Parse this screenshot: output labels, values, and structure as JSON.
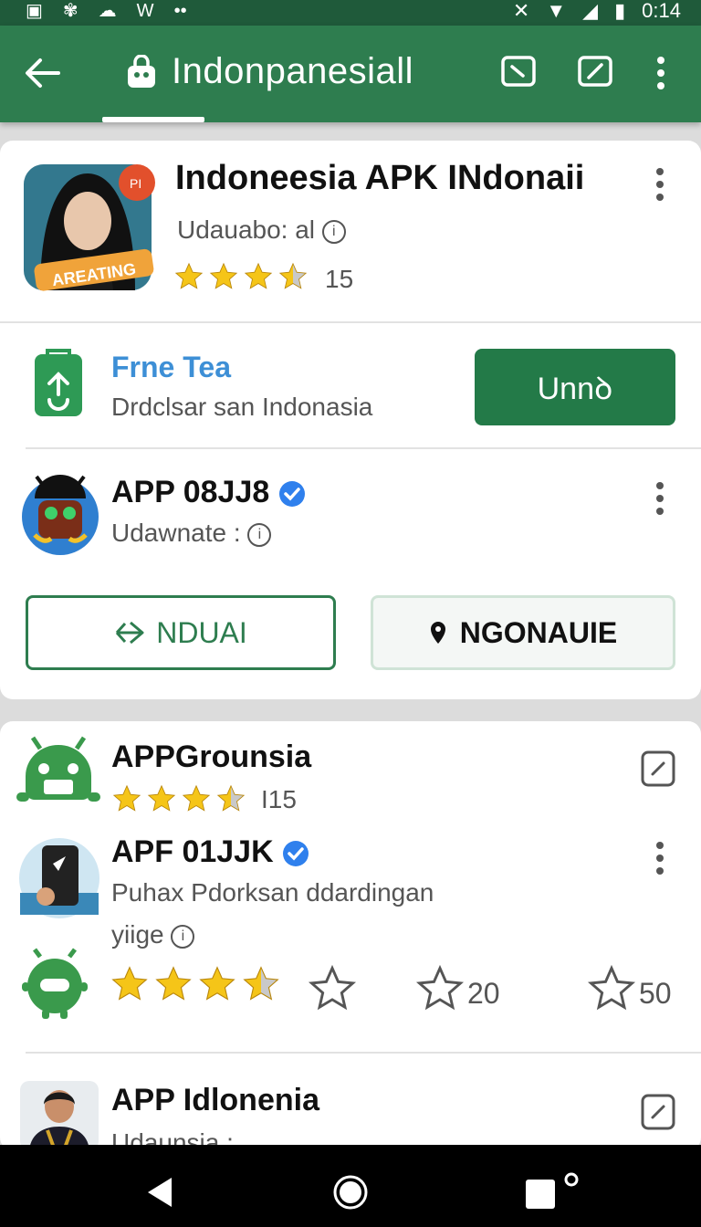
{
  "status_bar": {
    "time": "0:14"
  },
  "app_bar": {
    "title": "Indonpanesiall",
    "underline": true
  },
  "colors": {
    "brand": "#2e7d4f",
    "brand_dark": "#1f5a3a",
    "accent": "#237a48",
    "star": "#f5c518",
    "verified": "#2f80ed",
    "link_blue": "#3d8fd6"
  },
  "featured": {
    "title": "Indoneesia APK INdonaii",
    "subtitle": "Udauabo: al",
    "badge_label": "AREATING",
    "badge_corner": "PI",
    "rating": 3.5,
    "rating_count": "15"
  },
  "promo": {
    "title": "Frne Tea",
    "subtitle": "Drdclsar san Indonasia",
    "button_label": "Unnꝺ"
  },
  "app1": {
    "title": "APP 08JJ8",
    "subtitle": "Udawnate :",
    "button1_label": "NDUAI",
    "button2_label": "NGONAUIE"
  },
  "list": [
    {
      "title": "APPGrounsia",
      "rating": 3.5,
      "count": "I15",
      "icon": "android-robot-icon"
    },
    {
      "title": "APF 01JJK",
      "subtitle": "Puhax Pdorksan ddardingan",
      "sub2": "yiige",
      "icon": "phone-app-icon"
    },
    {
      "rating_row": {
        "rating": 3.5,
        "count1": "20",
        "count2": "50"
      }
    },
    {
      "title": "APP Idlonenia",
      "subtitle": "Udaunsia :",
      "icon": "person-avatar-icon"
    }
  ]
}
